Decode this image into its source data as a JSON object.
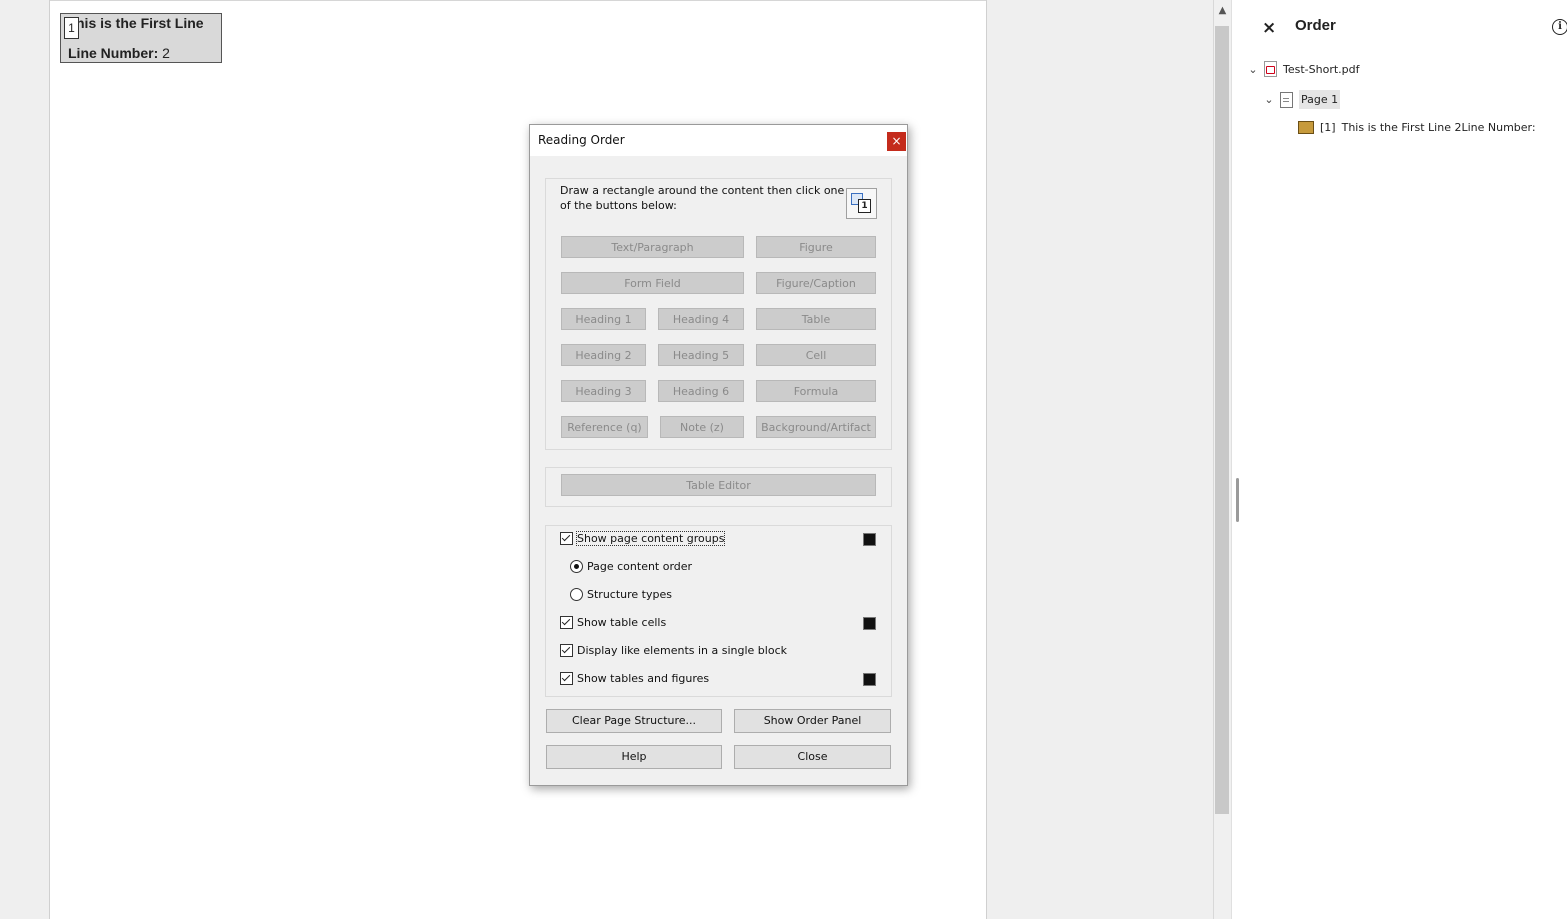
{
  "document": {
    "group_badge": "1",
    "line1": "his is the First Line",
    "line2_label": "Line Number:",
    "line2_value": "2"
  },
  "order_panel": {
    "title": "Order",
    "close_glyph": "×",
    "info_glyph": "i",
    "tree": {
      "file": "Test-Short.pdf",
      "page": "Page 1",
      "item_index": "[1]",
      "item_text": "This is the First Line 2Line Number:"
    },
    "icons": {
      "file": "pdf-file-icon",
      "page": "page-icon",
      "item": "content-box-icon"
    }
  },
  "dialog": {
    "title": "Reading Order",
    "close_glyph": "×",
    "instructions": "Draw a rectangle around the content then click one of the buttons below:",
    "tag_buttons": {
      "text_paragraph": "Text/Paragraph",
      "figure": "Figure",
      "form_field": "Form Field",
      "figure_caption": "Figure/Caption",
      "heading1": "Heading 1",
      "heading4": "Heading 4",
      "table": "Table",
      "heading2": "Heading 2",
      "heading5": "Heading 5",
      "cell": "Cell",
      "heading3": "Heading 3",
      "heading6": "Heading 6",
      "formula": "Formula",
      "reference": "Reference (q)",
      "note": "Note (z)",
      "background": "Background/Artifact"
    },
    "table_editor": "Table Editor",
    "options": {
      "show_page_content_groups": "Show page content groups",
      "page_content_order": "Page content order",
      "structure_types": "Structure types",
      "show_table_cells": "Show table cells",
      "display_like_elements": "Display like elements in a single block",
      "show_tables_and_figures": "Show tables and figures"
    },
    "buttons": {
      "clear_page_structure": "Clear Page Structure...",
      "show_order_panel": "Show Order Panel",
      "help": "Help",
      "close": "Close"
    },
    "colors": {
      "swatch": "#111111",
      "close_button": "#c42b1c"
    }
  }
}
